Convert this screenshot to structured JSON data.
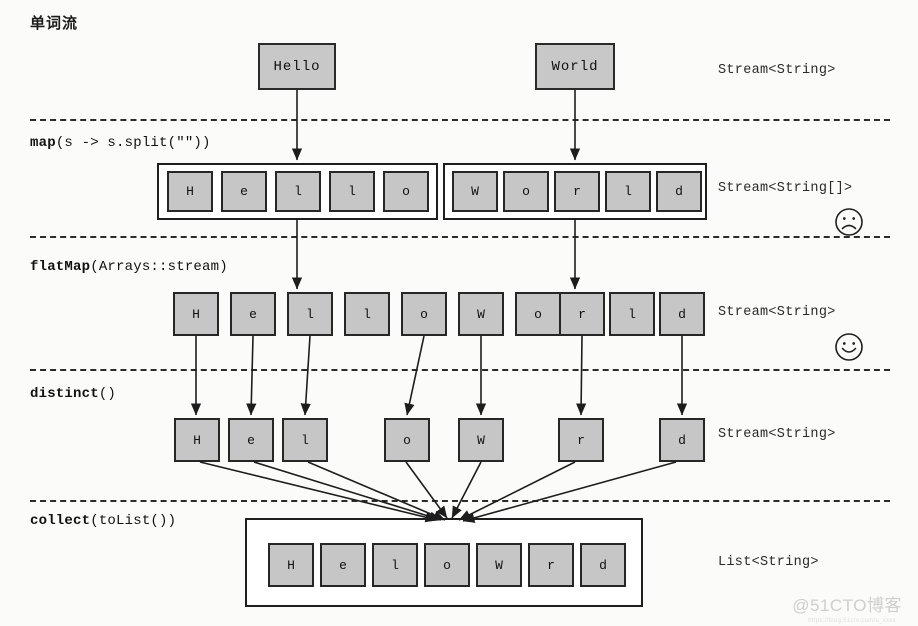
{
  "title": "单词流",
  "watermark": {
    "text": "@51CTO博客",
    "subtext": "https://blog.51cto.com/u_xxxx"
  },
  "stages": [
    {
      "id": "source",
      "label_bold": "",
      "label_rest": "",
      "type_label": "Stream<String>",
      "face": ""
    },
    {
      "id": "map",
      "label_bold": "map",
      "label_rest": "(s -> s.split(\"\"))",
      "type_label": "Stream<String[]>",
      "face": "sad"
    },
    {
      "id": "flatmap",
      "label_bold": "flatMap",
      "label_rest": "(Arrays::stream)",
      "type_label": "Stream<String>",
      "face": "happy"
    },
    {
      "id": "distinct",
      "label_bold": "distinct",
      "label_rest": "()",
      "type_label": "Stream<String>",
      "face": ""
    },
    {
      "id": "collect",
      "label_bold": "collect",
      "label_rest": "(toList())",
      "type_label": "List<String>",
      "face": ""
    }
  ],
  "row_source": {
    "words": [
      "Hello",
      "World"
    ]
  },
  "row_map": {
    "arrays": [
      {
        "name": "hello-array",
        "chars": [
          "H",
          "e",
          "l",
          "l",
          "o"
        ]
      },
      {
        "name": "world-array",
        "chars": [
          "W",
          "o",
          "r",
          "l",
          "d"
        ]
      }
    ]
  },
  "row_flatmap": {
    "chars": [
      "H",
      "e",
      "l",
      "l",
      "o",
      "W",
      "o",
      "r",
      "l",
      "d"
    ]
  },
  "row_distinct": {
    "chars": [
      "H",
      "e",
      "l",
      "o",
      "W",
      "r",
      "d"
    ]
  },
  "row_collect": {
    "list": [
      "H",
      "e",
      "l",
      "o",
      "W",
      "r",
      "d"
    ]
  },
  "colors": {
    "box_fill": "#c6c6c6",
    "stroke": "#262626",
    "separator": "#2b2b2b",
    "background": "#fbfbfa",
    "watermark": "#cfcfcf"
  },
  "faces": {
    "sad": "sad-face-icon",
    "happy": "happy-face-icon"
  }
}
